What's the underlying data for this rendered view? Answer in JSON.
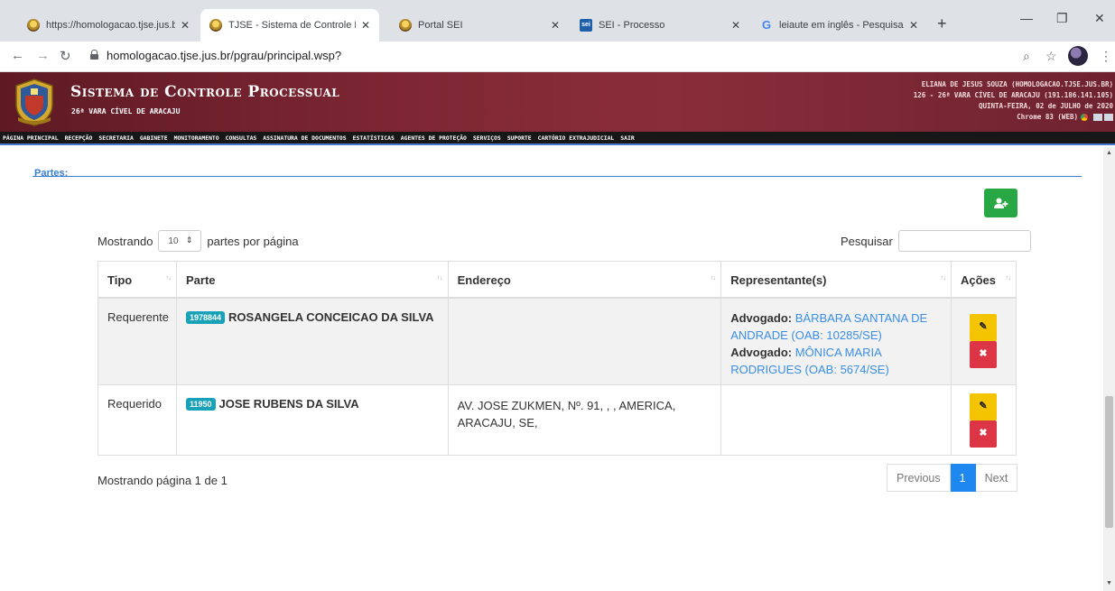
{
  "browser": {
    "tabs": [
      {
        "title": "https://homologacao.tjse.jus.br",
        "favicon": "seal-icon"
      },
      {
        "title": "TJSE - Sistema de Controle Pro",
        "favicon": "seal-icon"
      },
      {
        "title": "Portal SEI",
        "favicon": "seal-icon"
      },
      {
        "title": "SEI - Processo",
        "favicon": "sei-icon"
      },
      {
        "title": "leiaute em inglês - Pesquisa G",
        "favicon": "google-icon"
      }
    ],
    "active_tab_index": 1,
    "url": "homologacao.tjse.jus.br/pgrau/principal.wsp?"
  },
  "header": {
    "title": "Sistema de Controle Processual",
    "subtitle": "26ª VARA CÍVEL DE ARACAJU",
    "user_lines": [
      "ELIANA DE JESUS SOUZA (HOMOLOGACAO.TJSE.JUS.BR)",
      "126 - 26ª VARA CÍVEL DE ARACAJU (191.186.141.105)",
      "QUINTA-FEIRA, 02 de JULHO de 2020",
      "Chrome 83 (WEB)"
    ]
  },
  "menu": [
    "PÁGINA PRINCIPAL",
    "RECEPÇÃO",
    "SECRETARIA",
    "GABINETE",
    "MONITORAMENTO",
    "CONSULTAS",
    "ASSINATURA DE DOCUMENTOS",
    "ESTATÍSTICAS",
    "AGENTES DE PROTEÇÃO",
    "SERVIÇOS",
    "SUPORTE",
    "CARTÓRIO EXTRAJUDICIAL",
    "SAIR"
  ],
  "section": {
    "label": "Partes:"
  },
  "table_controls": {
    "show_prefix": "Mostrando",
    "page_size": "10",
    "show_suffix": "partes por página",
    "search_label": "Pesquisar",
    "search_value": ""
  },
  "columns": [
    "Tipo",
    "Parte",
    "Endereço",
    "Representante(s)",
    "Ações"
  ],
  "rows": [
    {
      "tipo": "Requerente",
      "badge": "1978844",
      "parte": "ROSANGELA CONCEICAO DA SILVA",
      "endereco": "",
      "reps": [
        {
          "label": "Advogado:",
          "name": "BÁRBARA SANTANA DE ANDRADE (OAB: 10285/SE)"
        },
        {
          "label": "Advogado:",
          "name": "MÔNICA MARIA RODRIGUES (OAB: 5674/SE)"
        }
      ]
    },
    {
      "tipo": "Requerido",
      "badge": "11950",
      "parte": "JOSE RUBENS DA SILVA",
      "endereco": "AV. JOSE ZUKMEN, Nº. 91, , , AMERICA, ARACAJU, SE,",
      "reps": []
    }
  ],
  "footer": {
    "info": "Mostrando página 1 de 1",
    "prev": "Previous",
    "current_page": "1",
    "next": "Next"
  },
  "colors": {
    "header_bg": "#7d2633",
    "menu_bg": "#171717",
    "link": "#3a8ee6",
    "badge": "#17a2b8",
    "add_button": "#28a745",
    "edit_button": "#f5c400",
    "delete_button": "#dc3545",
    "page_active": "#1e87f0"
  }
}
